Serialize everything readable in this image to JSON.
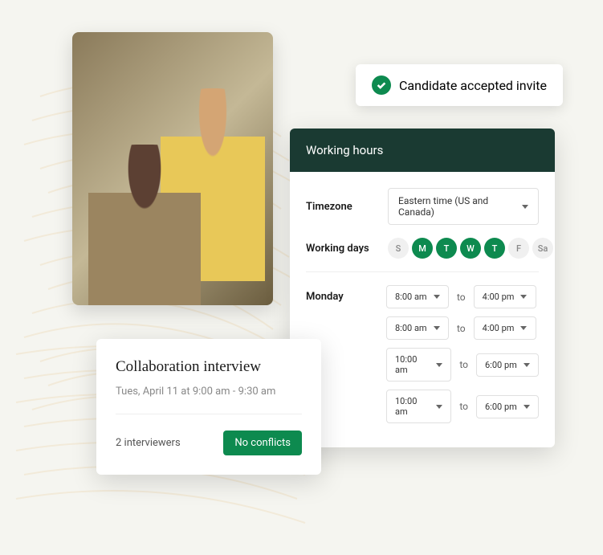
{
  "status": {
    "label": "Candidate accepted invite"
  },
  "workingHours": {
    "title": "Working hours",
    "timezoneLabel": "Timezone",
    "timezone": "Eastern time (US and Canada)",
    "workingDaysLabel": "Working days",
    "days": [
      {
        "abbr": "S",
        "active": false
      },
      {
        "abbr": "M",
        "active": true
      },
      {
        "abbr": "T",
        "active": true
      },
      {
        "abbr": "W",
        "active": true
      },
      {
        "abbr": "T",
        "active": true
      },
      {
        "abbr": "F",
        "active": false
      },
      {
        "abbr": "Sa",
        "active": false
      }
    ],
    "dayName": "Monday",
    "toLabel": "to",
    "slots": [
      {
        "start": "8:00 am",
        "end": "4:00 pm"
      },
      {
        "start": "8:00 am",
        "end": "4:00 pm"
      },
      {
        "start": "10:00 am",
        "end": "6:00 pm"
      },
      {
        "start": "10:00 am",
        "end": "6:00 pm"
      }
    ]
  },
  "interview": {
    "title": "Collaboration interview",
    "datetime": "Tues, April 11  at 9:00 am - 9:30 am",
    "interviewersCount": "2 interviewers",
    "conflictsLabel": "No conflicts"
  }
}
